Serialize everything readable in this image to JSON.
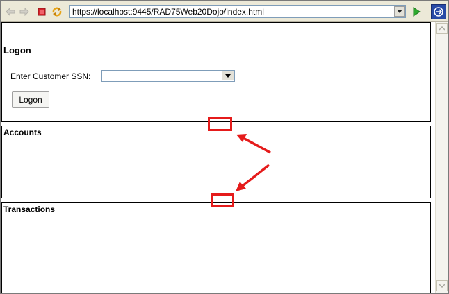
{
  "browser": {
    "url": "https://localhost:9445/RAD75Web20Dojo/index.html"
  },
  "logon_pane": {
    "title": "Logon",
    "ssn_label": "Enter Customer SSN:",
    "ssn_selected": "",
    "logon_button": "Logon"
  },
  "accounts_pane": {
    "title": "Accounts"
  },
  "transactions_pane": {
    "title": "Transactions"
  },
  "colors": {
    "annotation": "#e51b1b",
    "toolbar": "#ece9d8"
  }
}
